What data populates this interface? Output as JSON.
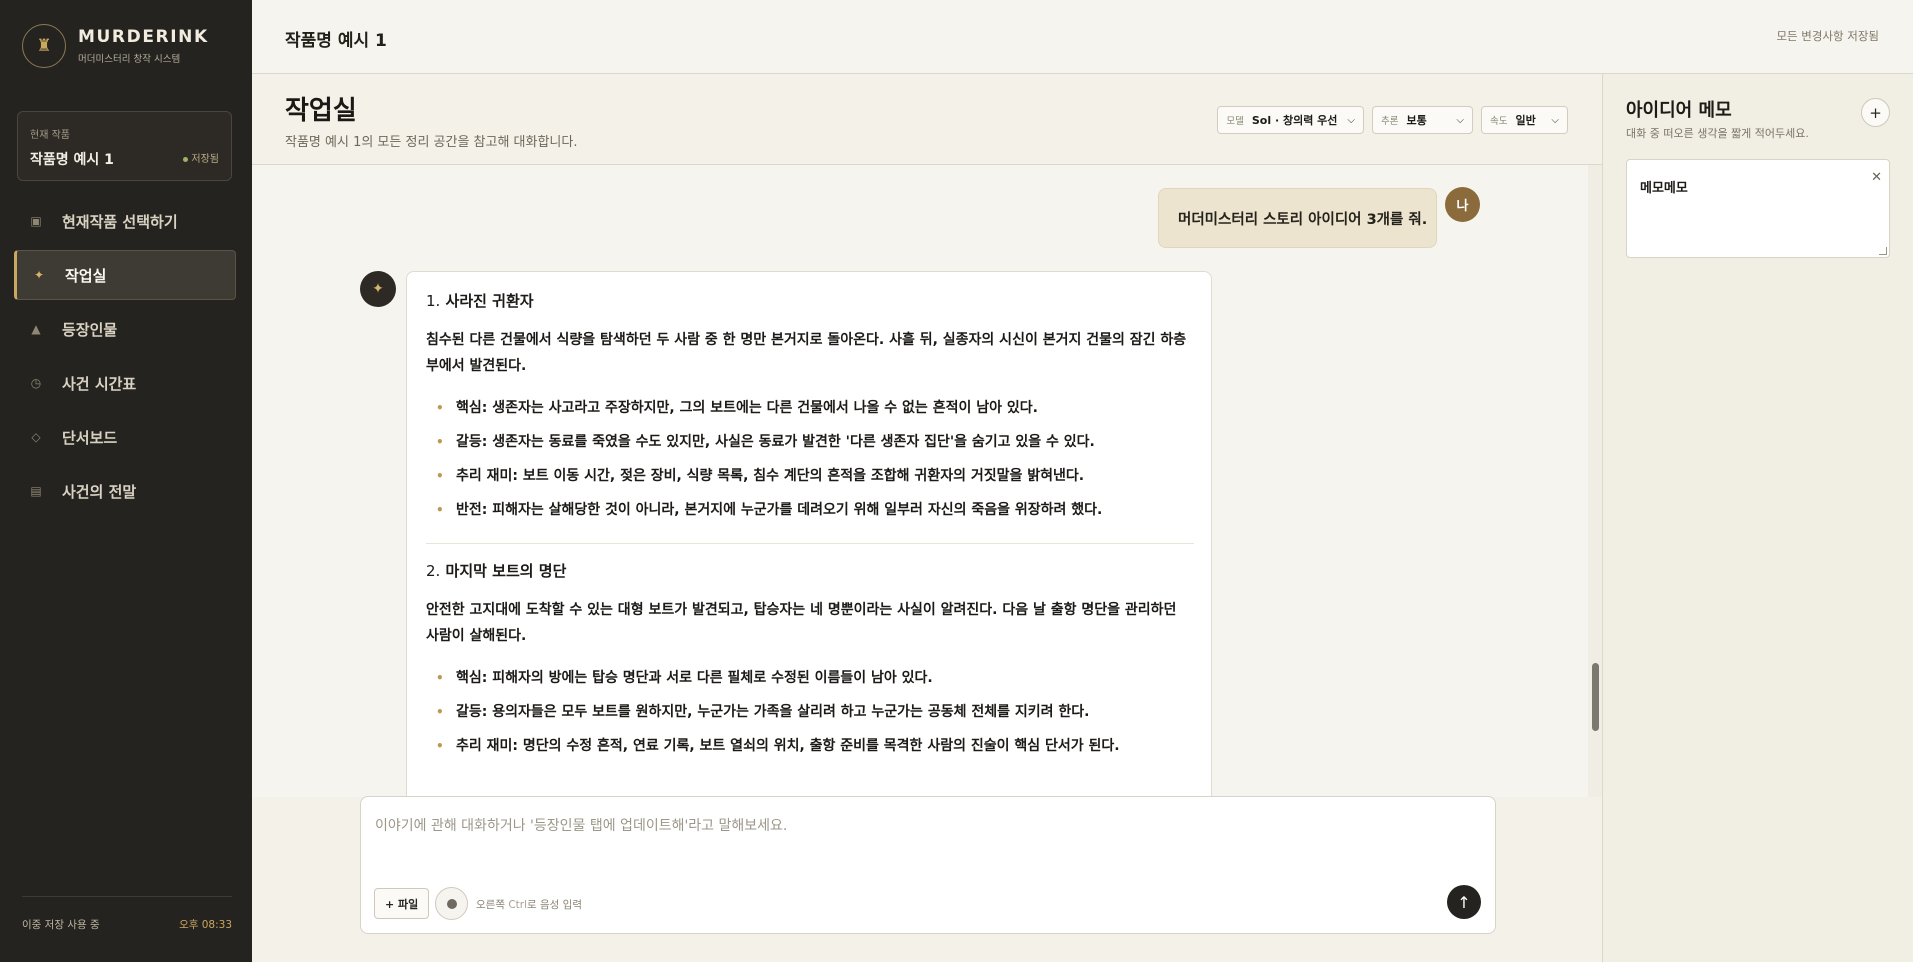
{
  "brand": {
    "name": "MURDERINK",
    "subtitle": "머더미스터리 창작 시스템",
    "logo_icon": "rook-icon"
  },
  "current_work": {
    "label": "현재 작품",
    "title": "작품명 예시 1",
    "status": "저장됨"
  },
  "nav": [
    {
      "label": "현재작품 선택하기",
      "icon": "square-icon",
      "active": false
    },
    {
      "label": "작업실",
      "icon": "sparkle-icon",
      "active": true
    },
    {
      "label": "등장인물",
      "icon": "person-icon",
      "active": false
    },
    {
      "label": "사건 시간표",
      "icon": "clock-icon",
      "active": false
    },
    {
      "label": "단서보드",
      "icon": "diamond-icon",
      "active": false
    },
    {
      "label": "사건의 전말",
      "icon": "document-icon",
      "active": false
    }
  ],
  "footer": {
    "storage": "이중 저장 사용 중",
    "time": "오후 08:33"
  },
  "topbar": {
    "title": "작품명 예시 1",
    "status": "모든 변경사항 저장됨"
  },
  "workspace": {
    "title": "작업실",
    "description": "작품명 예시 1의 모든 정리 공간을 참고해 대화합니다.",
    "selects": [
      {
        "key": "모델",
        "value": "Sol · 창의력 우선"
      },
      {
        "key": "추론",
        "value": "보통"
      },
      {
        "key": "속도",
        "value": "일반"
      }
    ]
  },
  "chat": {
    "user_avatar": "나",
    "user_message": "머더미스터리 스토리 아이디어 3개를 줘.",
    "ideas": [
      {
        "num": "1.",
        "title": "사라진 귀환자",
        "summary": "침수된 다른 건물에서 식량을 탐색하던 두 사람 중 한 명만 본거지로 돌아온다. 사흘 뒤, 실종자의 시신이 본거지 건물의 잠긴 하층부에서 발견된다.",
        "points": [
          "핵심: 생존자는 사고라고 주장하지만, 그의 보트에는 다른 건물에서 나올 수 없는 흔적이 남아 있다.",
          "갈등: 생존자는 동료를 죽였을 수도 있지만, 사실은 동료가 발견한 '다른 생존자 집단'을 숨기고 있을 수 있다.",
          "추리 재미: 보트 이동 시간, 젖은 장비, 식량 목록, 침수 계단의 흔적을 조합해 귀환자의 거짓말을 밝혀낸다.",
          "반전: 피해자는 살해당한 것이 아니라, 본거지에 누군가를 데려오기 위해 일부러 자신의 죽음을 위장하려 했다."
        ]
      },
      {
        "num": "2.",
        "title": "마지막 보트의 명단",
        "summary": "안전한 고지대에 도착할 수 있는 대형 보트가 발견되고, 탑승자는 네 명뿐이라는 사실이 알려진다. 다음 날 출항 명단을 관리하던 사람이 살해된다.",
        "points": [
          "핵심: 피해자의 방에는 탑승 명단과 서로 다른 필체로 수정된 이름들이 남아 있다.",
          "갈등: 용의자들은 모두 보트를 원하지만, 누군가는 가족을 살리려 하고 누군가는 공동체 전체를 지키려 한다.",
          "추리 재미: 명단의 수정 흔적, 연료 기록, 보트 열쇠의 위치, 출항 준비를 목격한 사람의 진술이 핵심 단서가 된다."
        ]
      }
    ]
  },
  "composer": {
    "placeholder": "이야기에 관해 대화하거나 '등장인물 탭에 업데이트해'라고 말해보세요.",
    "file_label": "+ 파일",
    "voice_hint_prefix": "오른쪽",
    "voice_hint_key": "Ctrl",
    "voice_hint_suffix": "로 음성 입력"
  },
  "memo": {
    "title": "아이디어 메모",
    "description": "대화 중 떠오른 생각을 짧게 적어두세요.",
    "note_text": "메모메모"
  }
}
